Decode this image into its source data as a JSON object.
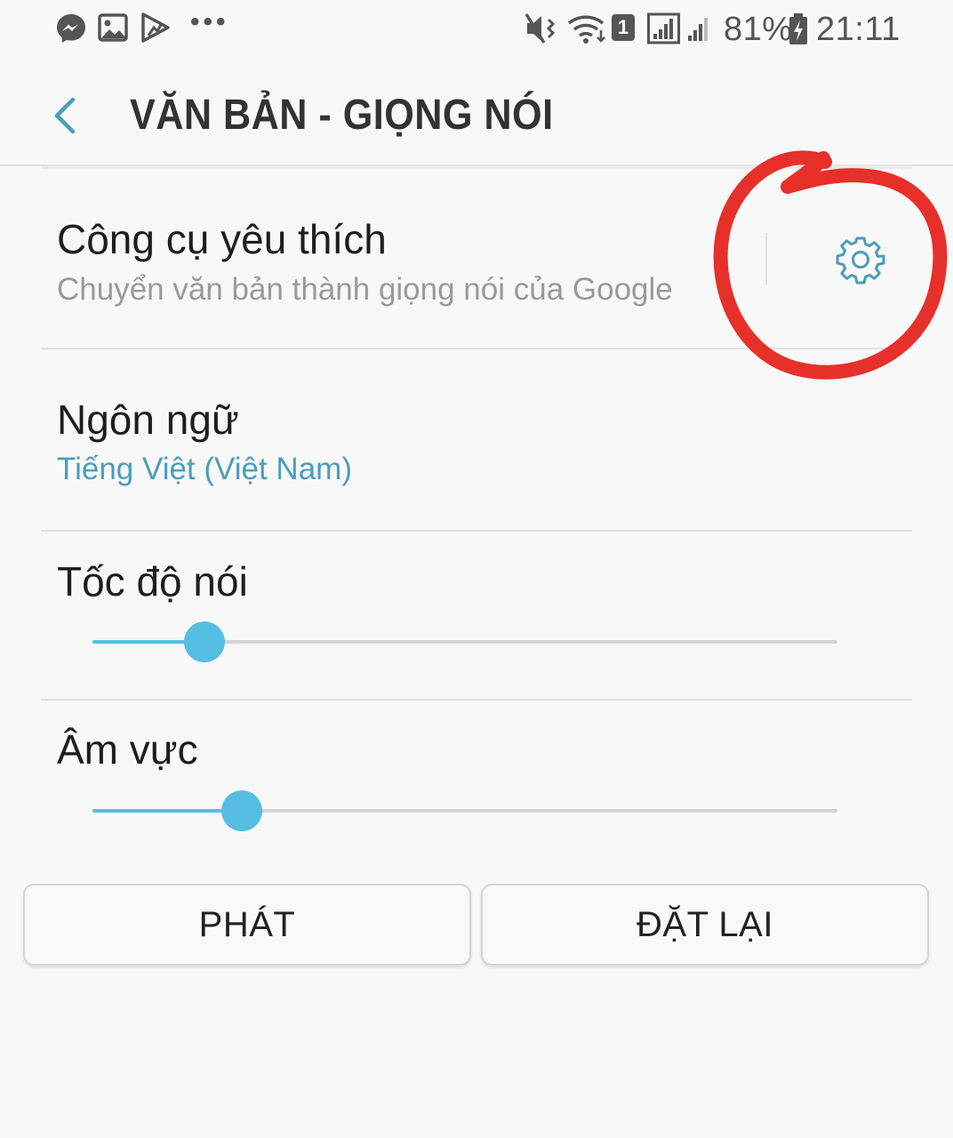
{
  "status_bar": {
    "icons": [
      "messenger-icon",
      "gallery-icon",
      "play-store-icon",
      "more-dots-icon",
      "mute-vibrate-icon",
      "wifi-icon",
      "sim-1-icon",
      "signal-sim1-icon",
      "signal-sim2-icon",
      "battery-charging-icon"
    ],
    "more": "•••",
    "sim_slot": "1",
    "battery": "81%",
    "time": "21:11"
  },
  "header": {
    "back_icon": "chevron-left-icon",
    "title": "VĂN BẢN - GIỌNG NÓI"
  },
  "settings": {
    "engine": {
      "title": "Công cụ yêu thích",
      "subtitle": "Chuyển văn bản thành giọng nói của Google",
      "settings_icon": "gear-icon"
    },
    "language": {
      "title": "Ngôn ngữ",
      "value": "Tiếng Việt (Việt Nam)"
    },
    "speech_rate": {
      "title": "Tốc độ nói",
      "level": 0.15
    },
    "pitch": {
      "title": "Âm vực",
      "level": 0.2
    }
  },
  "buttons": {
    "play": "PHÁT",
    "reset": "ĐẶT LẠI"
  },
  "colors": {
    "accent": "#56bee2",
    "link_blue": "#4a9dbd",
    "annotation_red": "#e8302a",
    "background": "#f8f8f8"
  }
}
